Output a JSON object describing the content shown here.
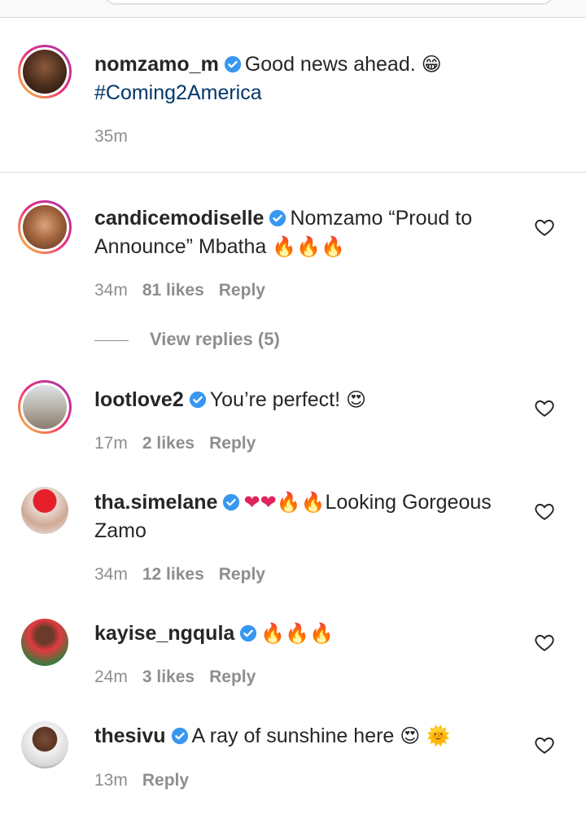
{
  "caption": {
    "username": "nomzamo_m",
    "text": "Good news ahead.",
    "emoji": "😁",
    "hashtag": "#Coming2America",
    "time": "35m"
  },
  "view_replies_label": "View replies (5)",
  "comments": [
    {
      "username": "candicemodiselle",
      "text": "Nomzamo “Proud to Announce” Mbatha",
      "emoji": "🔥🔥🔥",
      "time": "34m",
      "likes": "81 likes",
      "reply": "Reply"
    },
    {
      "username": "lootlove2",
      "text": "You’re perfect!",
      "emoji": "😍",
      "time": "17m",
      "likes": "2 likes",
      "reply": "Reply"
    },
    {
      "username": "tha.simelane",
      "emoji_before": "❤❤🔥🔥",
      "text": "Looking Gorgeous Zamo",
      "time": "34m",
      "likes": "12 likes",
      "reply": "Reply"
    },
    {
      "username": "kayise_ngqula",
      "emoji": "🔥🔥🔥",
      "time": "24m",
      "likes": "3 likes",
      "reply": "Reply"
    },
    {
      "username": "thesivu",
      "text": "A ray of sunshine here",
      "emoji": "😍 🌞",
      "time": "13m",
      "reply": "Reply"
    }
  ],
  "colors": {
    "verified": "#3897f0",
    "hashtag": "#00376b",
    "meta": "#8e8e8e",
    "fire": "#ff5a1f",
    "heart_red": "#e0245e"
  }
}
